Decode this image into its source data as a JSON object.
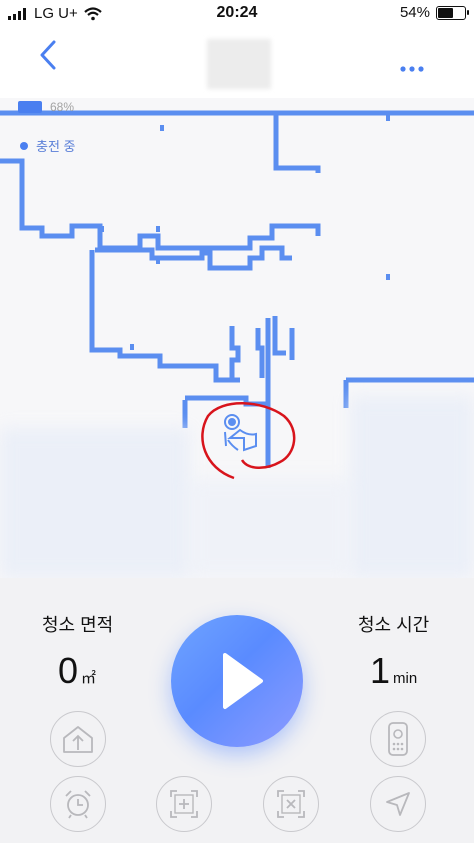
{
  "status_bar": {
    "carrier": "LG U+",
    "time": "20:24",
    "battery_pct": "54%"
  },
  "header": {
    "back_icon": "chevron-left-icon",
    "more_icon": "ellipsis-icon"
  },
  "map": {
    "robot_battery_pct": "68%",
    "charging_status": "충전 중"
  },
  "panel": {
    "area_label": "청소 면적",
    "area_value": "0",
    "area_unit": "㎡",
    "time_label": "청소 시간",
    "time_value": "1",
    "time_unit": "min",
    "buttons": [
      {
        "name": "home-dock",
        "icon": "home-up-arrow-icon"
      },
      {
        "name": "remote",
        "icon": "remote-control-icon"
      },
      {
        "name": "schedule",
        "icon": "alarm-clock-icon"
      },
      {
        "name": "spot-clean",
        "icon": "square-plus-icon"
      },
      {
        "name": "no-go-zone",
        "icon": "square-x-icon"
      },
      {
        "name": "navigate",
        "icon": "navigation-arrow-icon"
      }
    ]
  },
  "colors": {
    "accent": "#4a7ff0",
    "wall": "#5b8ef0",
    "annotation": "#d8141c"
  }
}
